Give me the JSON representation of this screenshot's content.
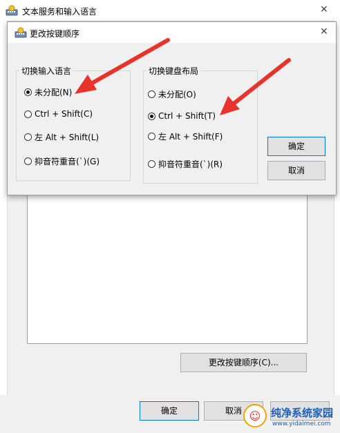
{
  "outer_window": {
    "title": "文本服务和输入语言",
    "change_sequence_button": "更改按键顺序(C)...",
    "ok_button": "确定",
    "cancel_button": "取消",
    "close_glyph": "✕"
  },
  "dialog": {
    "title": "更改按键顺序",
    "close_glyph": "✕",
    "input_language_group": {
      "label": "切换输入语言",
      "options": [
        {
          "label": "未分配(N)",
          "checked": true
        },
        {
          "label": "Ctrl + Shift(C)",
          "checked": false
        },
        {
          "label": "左 Alt + Shift(L)",
          "checked": false
        },
        {
          "label": "抑音符重音(`)(G)",
          "checked": false
        }
      ]
    },
    "keyboard_layout_group": {
      "label": "切换键盘布局",
      "options": [
        {
          "label": "未分配(O)",
          "checked": false
        },
        {
          "label": "Ctrl + Shift(T)",
          "checked": true
        },
        {
          "label": "左 Alt + Shift(F)",
          "checked": false
        },
        {
          "label": "抑音符重音(`)(R)",
          "checked": false
        }
      ]
    },
    "ok_button": "确定",
    "cancel_button": "取消"
  },
  "watermark": {
    "brand": "纯净系统家园",
    "url": "www.yidaimei.com"
  },
  "colors": {
    "annotation_arrow": "#e8332a",
    "watermark_blue": "#1d5fb8",
    "accent_border": "#0078d7"
  }
}
